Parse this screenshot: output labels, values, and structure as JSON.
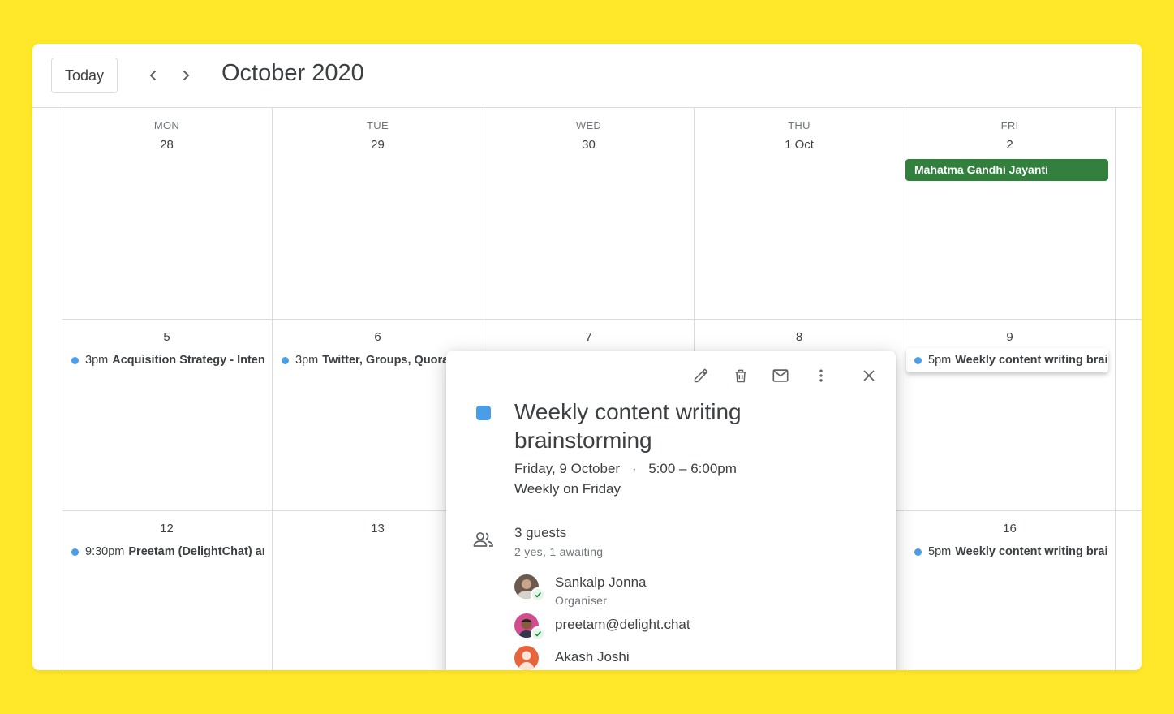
{
  "header": {
    "today_label": "Today",
    "month_title": "October 2020"
  },
  "calendar": {
    "weeks": [
      {
        "days": [
          {
            "dow": "MON",
            "num": "28"
          },
          {
            "dow": "TUE",
            "num": "29"
          },
          {
            "dow": "WED",
            "num": "30"
          },
          {
            "dow": "THU",
            "num": "1 Oct"
          },
          {
            "dow": "FRI",
            "num": "2"
          }
        ]
      },
      {
        "days": [
          {
            "num": "5"
          },
          {
            "num": "6"
          },
          {
            "num": "7"
          },
          {
            "num": "8"
          },
          {
            "num": "9"
          }
        ]
      },
      {
        "days": [
          {
            "num": "12"
          },
          {
            "num": "13"
          },
          {
            "num": ""
          },
          {
            "num": ""
          },
          {
            "num": "16"
          }
        ]
      }
    ],
    "allday_event": "Mahatma Gandhi Jayanti",
    "events": [
      {
        "time": "3pm",
        "title": "Acquisition Strategy - Intens"
      },
      {
        "time": "3pm",
        "title": "Twitter, Groups, Quora"
      },
      {
        "time": "5pm",
        "title": "Weekly content writing brain"
      },
      {
        "time": "9:30pm",
        "title": "Preetam (DelightChat) ar"
      },
      {
        "time": "5pm",
        "title": "Weekly content writing brain"
      }
    ],
    "event_color": "#4a9ee8",
    "allday_color": "#33803e"
  },
  "popup": {
    "title": "Weekly content writing brainstorming",
    "date": "Friday, 9 October",
    "separator": "·",
    "time": "5:00 – 6:00pm",
    "recurrence": "Weekly on Friday",
    "guest_count": "3 guests",
    "guest_summary": "2 yes, 1 awaiting",
    "guests": [
      {
        "name": "Sankalp Jonna",
        "role": "Organiser"
      },
      {
        "name": "preetam@delight.chat",
        "role": ""
      },
      {
        "name": "Akash Joshi",
        "role": ""
      }
    ],
    "toolbar_icons": [
      "edit-icon",
      "trash-icon",
      "mail-icon",
      "more-vert-icon",
      "close-icon"
    ]
  }
}
